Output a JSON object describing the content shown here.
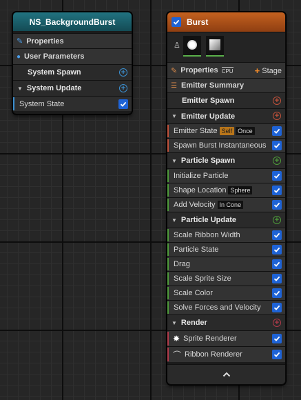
{
  "system_node": {
    "title": "NS_BackgroundBurst",
    "rows": {
      "properties": "Properties",
      "user_parameters": "User Parameters",
      "system_spawn": "System Spawn",
      "system_update": "System Update",
      "system_state": "System State"
    }
  },
  "emitter_node": {
    "title": "Burst",
    "properties_label": "Properties",
    "sim_target": "CPU",
    "stage_label": "Stage",
    "emitter_summary": "Emitter Summary",
    "emitter_spawn": "Emitter Spawn",
    "emitter_update": "Emitter Update",
    "emitter_state": "Emitter State",
    "emitter_state_tag1": "Self",
    "emitter_state_tag2": "Once",
    "spawn_burst": "Spawn Burst Instantaneous",
    "particle_spawn": "Particle Spawn",
    "initialize_particle": "Initialize Particle",
    "shape_location": "Shape Location",
    "shape_location_tag": "Sphere",
    "add_velocity": "Add Velocity",
    "add_velocity_tag": "In Cone",
    "particle_update": "Particle Update",
    "scale_ribbon_width": "Scale Ribbon Width",
    "particle_state": "Particle State",
    "drag": "Drag",
    "scale_sprite_size": "Scale Sprite Size",
    "scale_color": "Scale Color",
    "solve_forces": "Solve Forces and Velocity",
    "render": "Render",
    "sprite_renderer": "Sprite Renderer",
    "ribbon_renderer": "Ribbon Renderer"
  },
  "colors": {
    "system_header": "#1a5e6a",
    "emitter_header": "#b3541a",
    "emitter_accent": "#c0513a",
    "particle_accent": "#4d9a3a",
    "render_accent": "#b03a4a",
    "checkbox": "#1e63d6"
  }
}
